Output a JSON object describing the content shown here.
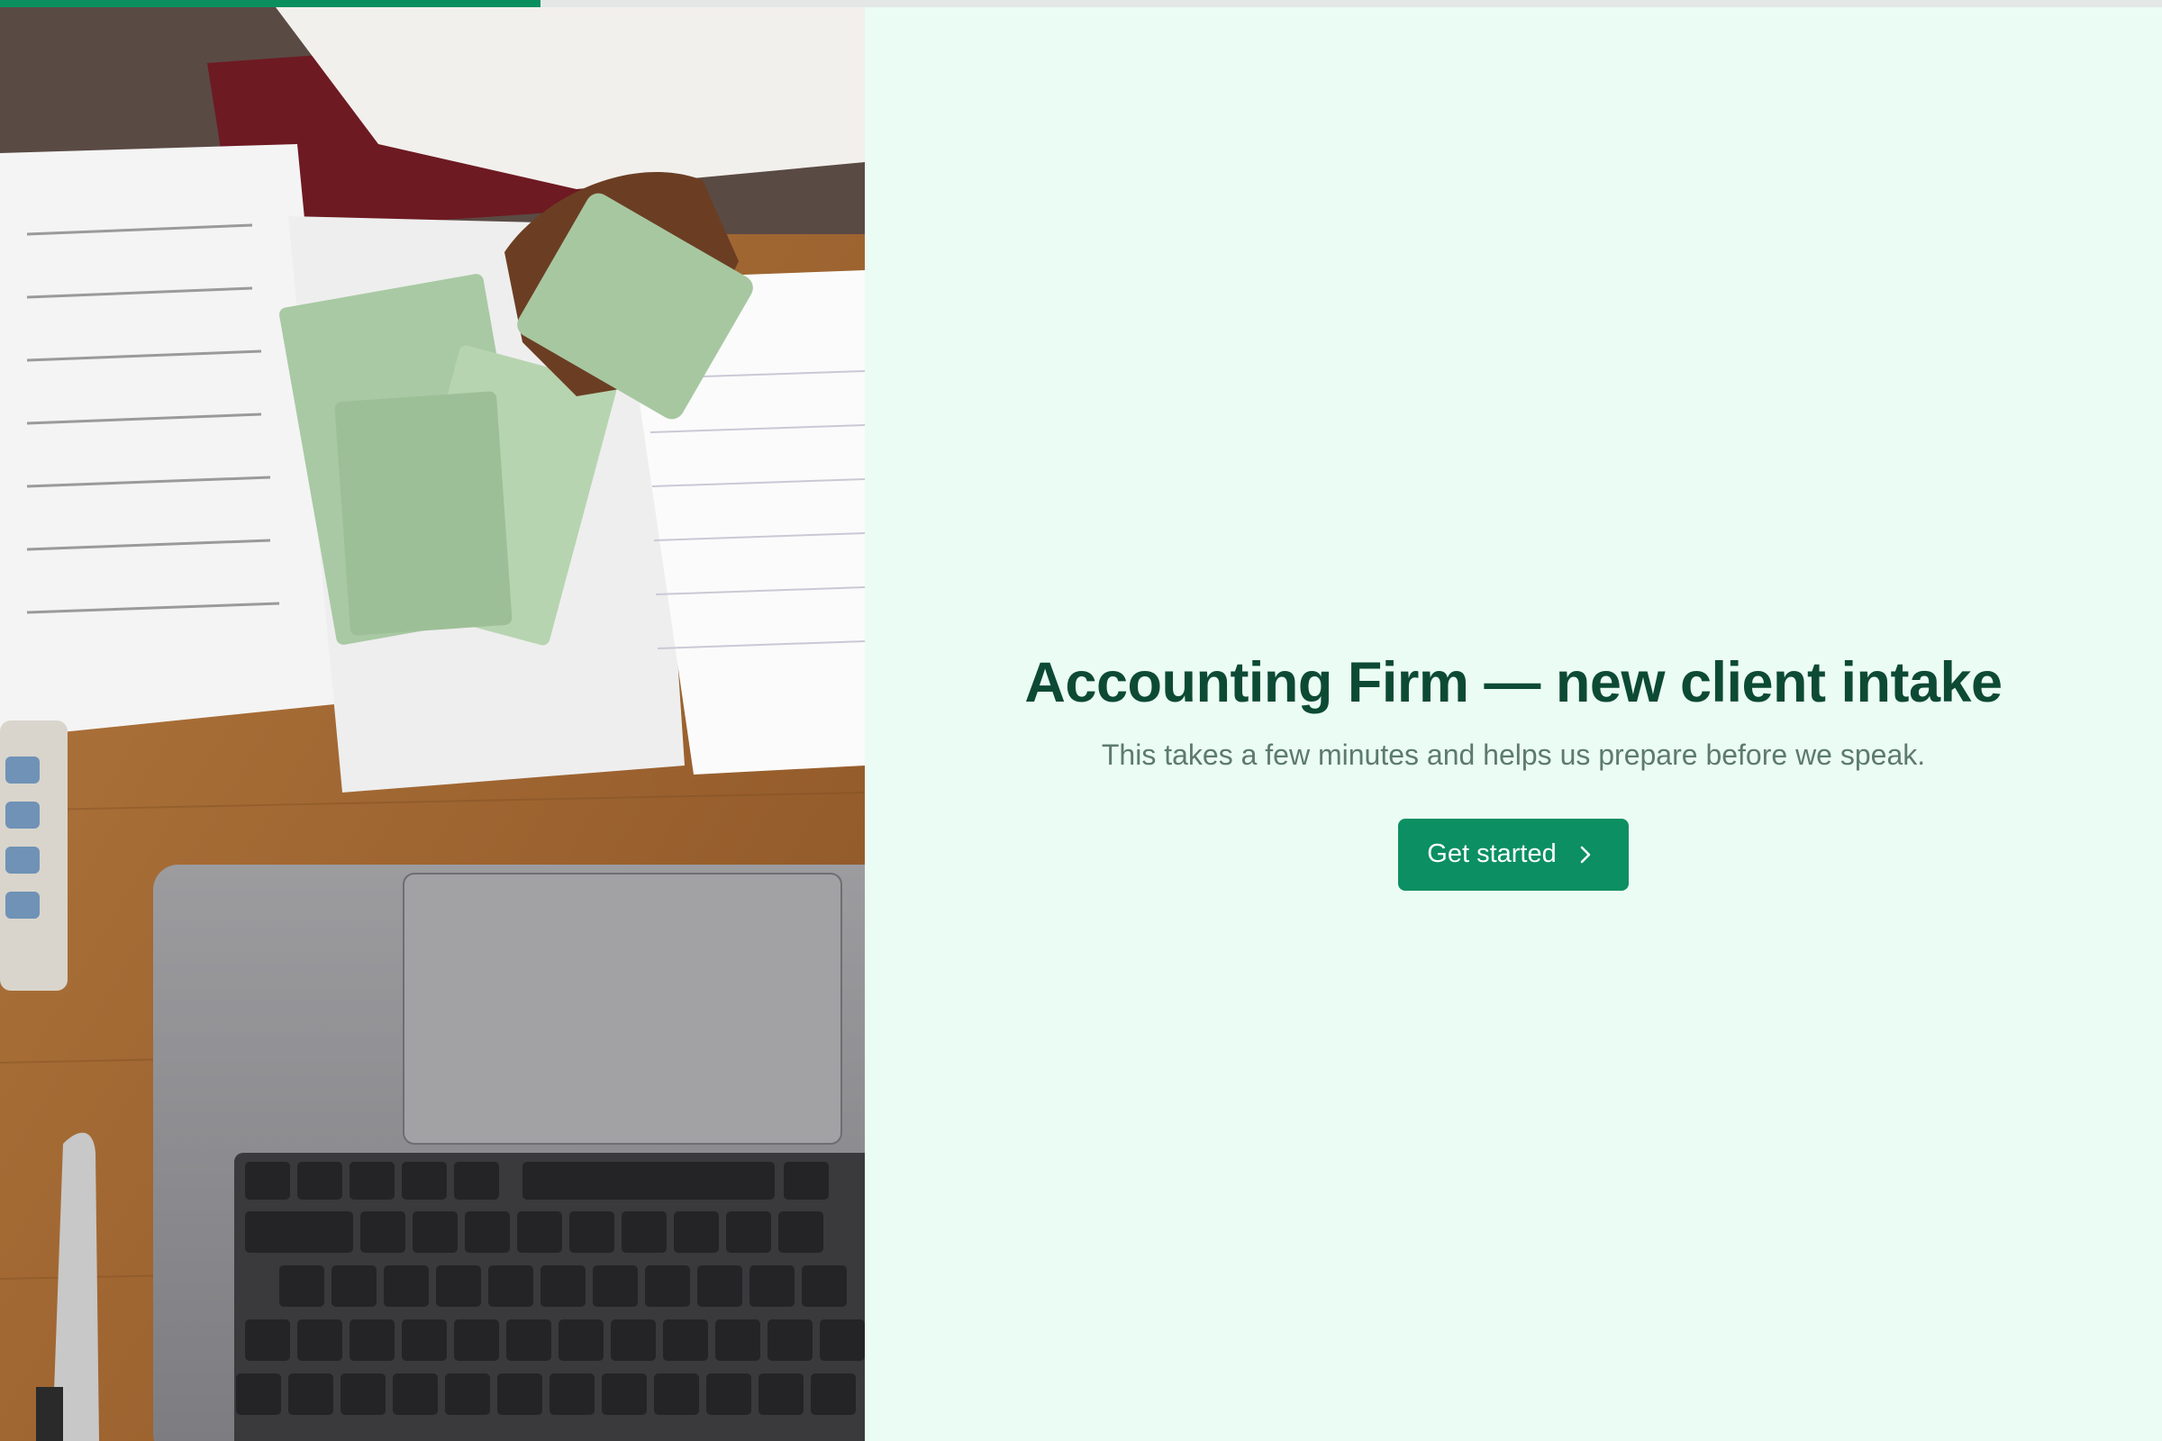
{
  "progress": {
    "value": 0.25
  },
  "hero_image": {
    "alt": "Hands counting euro banknotes over a balance sheet next to a laptop"
  },
  "intro": {
    "title": "Accounting Firm — new client intake",
    "subtitle": "This takes a few minutes and helps us prepare before we speak.",
    "cta_label": "Get started",
    "cta_icon": "chevron-right-icon"
  },
  "colors": {
    "accent": "#0b8f63",
    "title": "#0d4a35",
    "subtitle": "#5d7a6f",
    "background": "#ebfcf4"
  }
}
